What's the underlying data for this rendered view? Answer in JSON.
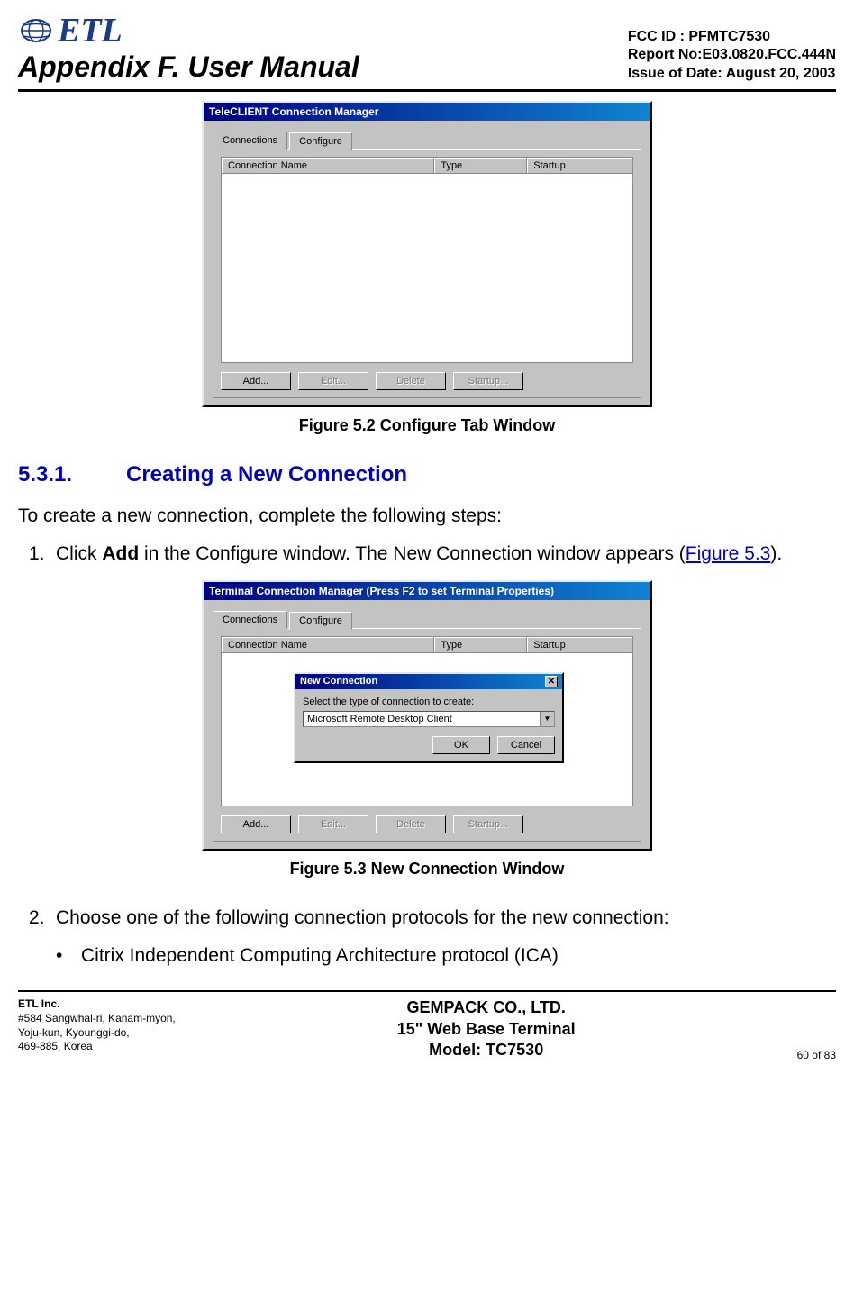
{
  "header": {
    "logo_text": "ETL",
    "title": "Appendix F. User Manual",
    "fcc": "FCC ID : PFMTC7530",
    "report": "Report No:E03.0820.FCC.444N",
    "issue": "Issue of Date:  August 20, 2003"
  },
  "fig52": {
    "window_title": "TeleCLIENT Connection Manager",
    "tab_connections": "Connections",
    "tab_configure": "Configure",
    "col_name": "Connection Name",
    "col_type": "Type",
    "col_startup": "Startup",
    "btn_add": "Add...",
    "btn_edit": "Edit...",
    "btn_delete": "Delete",
    "btn_startup": "Startup...",
    "caption": "Figure 5.2    Configure Tab Window"
  },
  "section": {
    "num": "5.3.1.",
    "title": "Creating a New Connection",
    "intro": "To create a new connection, complete the following steps:",
    "step1_pre": "1.",
    "step1_a": "Click ",
    "step1_bold": "Add",
    "step1_b": " in the Configure window. The New Connection window appears (",
    "step1_link": "Figure 5.3",
    "step1_c": ").",
    "step2_pre": "2.",
    "step2": "Choose one of the following connection protocols for the new connection:",
    "bullet_dot": "•",
    "bullet1": "Citrix Independent Computing Architecture protocol (ICA)"
  },
  "fig53": {
    "window_title": "Terminal Connection Manager (Press F2 to set Terminal Properties)",
    "tab_connections": "Connections",
    "tab_configure": "Configure",
    "col_name": "Connection Name",
    "col_type": "Type",
    "col_startup": "Startup",
    "dlg_title": "New Connection",
    "dlg_prompt": "Select the type of connection to create:",
    "dlg_option": "Microsoft Remote Desktop Client",
    "btn_ok": "OK",
    "btn_cancel": "Cancel",
    "btn_add": "Add...",
    "btn_edit": "Edit...",
    "btn_delete": "Delete",
    "btn_startup": "Startup...",
    "caption": "Figure 5.3    New Connection Window"
  },
  "footer": {
    "co": "ETL Inc.",
    "addr1": "#584 Sangwhal-ri, Kanam-myon,",
    "addr2": "Yoju-kun, Kyounggi-do,",
    "addr3": "469-885, Korea",
    "center1": "GEMPACK CO., LTD.",
    "center2": "15\" Web Base Terminal",
    "center3": "Model: TC7530",
    "page": "60 of  83"
  }
}
